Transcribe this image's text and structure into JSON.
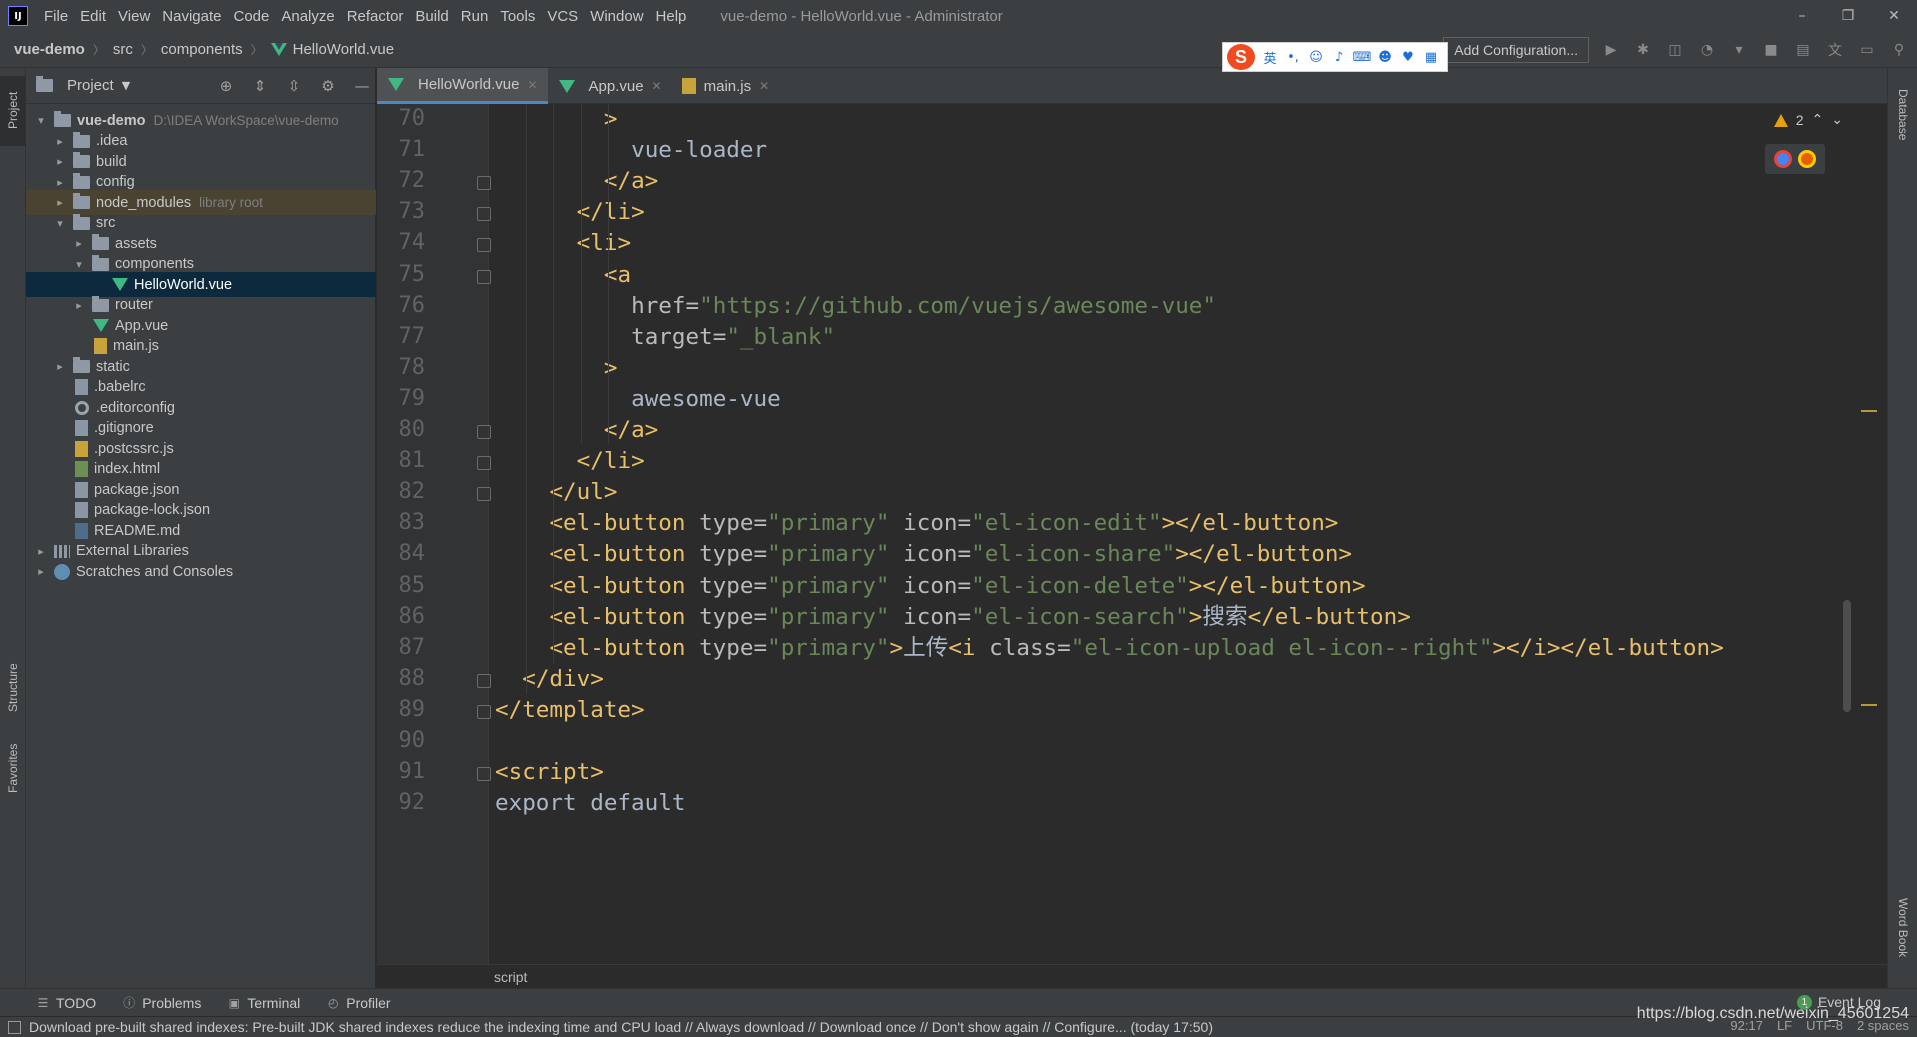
{
  "menu": [
    "File",
    "Edit",
    "View",
    "Navigate",
    "Code",
    "Analyze",
    "Refactor",
    "Build",
    "Run",
    "Tools",
    "VCS",
    "Window",
    "Help"
  ],
  "window_title": "vue-demo - HelloWorld.vue - Administrator",
  "breadcrumb": [
    "vue-demo",
    "src",
    "components",
    "HelloWorld.vue"
  ],
  "run_config_label": "Add Configuration...",
  "ime": {
    "mode": "英"
  },
  "left_strip": {
    "project": "Project",
    "structure": "Structure",
    "favorites": "Favorites"
  },
  "right_strip": {
    "database": "Database",
    "wordbook": "Word Book"
  },
  "project_panel": {
    "title": "Project",
    "tree": [
      {
        "name": "vue-demo",
        "extra": "D:\\IDEA WorkSpace\\vue-demo",
        "depth": 0,
        "kind": "module",
        "expanded": true
      },
      {
        "name": ".idea",
        "depth": 1,
        "kind": "folder",
        "expanded": false
      },
      {
        "name": "build",
        "depth": 1,
        "kind": "folder",
        "expanded": false
      },
      {
        "name": "config",
        "depth": 1,
        "kind": "folder",
        "expanded": false
      },
      {
        "name": "node_modules",
        "extra": "library root",
        "depth": 1,
        "kind": "folder",
        "expanded": false,
        "highlight": true
      },
      {
        "name": "src",
        "depth": 1,
        "kind": "folder",
        "expanded": true
      },
      {
        "name": "assets",
        "depth": 2,
        "kind": "folder",
        "expanded": false
      },
      {
        "name": "components",
        "depth": 2,
        "kind": "folder",
        "expanded": true
      },
      {
        "name": "HelloWorld.vue",
        "depth": 3,
        "kind": "vue",
        "selected": true
      },
      {
        "name": "router",
        "depth": 2,
        "kind": "folder",
        "expanded": false
      },
      {
        "name": "App.vue",
        "depth": 2,
        "kind": "vue"
      },
      {
        "name": "main.js",
        "depth": 2,
        "kind": "js"
      },
      {
        "name": "static",
        "depth": 1,
        "kind": "folder",
        "expanded": false
      },
      {
        "name": ".babelrc",
        "depth": 1,
        "kind": "file"
      },
      {
        "name": ".editorconfig",
        "depth": 1,
        "kind": "gear"
      },
      {
        "name": ".gitignore",
        "depth": 1,
        "kind": "file"
      },
      {
        "name": ".postcssrc.js",
        "depth": 1,
        "kind": "js"
      },
      {
        "name": "index.html",
        "depth": 1,
        "kind": "html"
      },
      {
        "name": "package.json",
        "depth": 1,
        "kind": "file"
      },
      {
        "name": "package-lock.json",
        "depth": 1,
        "kind": "file"
      },
      {
        "name": "README.md",
        "depth": 1,
        "kind": "md"
      },
      {
        "name": "External Libraries",
        "depth": 0,
        "kind": "lib",
        "expanded": false
      },
      {
        "name": "Scratches and Consoles",
        "depth": 0,
        "kind": "scratch",
        "expanded": false
      }
    ]
  },
  "tabs": [
    {
      "label": "HelloWorld.vue",
      "icon": "vue",
      "active": true
    },
    {
      "label": "App.vue",
      "icon": "vue",
      "active": false
    },
    {
      "label": "main.js",
      "icon": "js",
      "active": false
    }
  ],
  "editor": {
    "warnings": "2",
    "lines": [
      {
        "n": "70",
        "indent": 4,
        "tokens": [
          [
            "tg",
            ">"
          ]
        ]
      },
      {
        "n": "71",
        "indent": 5,
        "tokens": [
          [
            "tx",
            "vue-loader"
          ]
        ]
      },
      {
        "n": "72",
        "indent": 4,
        "tokens": [
          [
            "tg",
            "</a>"
          ]
        ]
      },
      {
        "n": "73",
        "indent": 3,
        "tokens": [
          [
            "tg",
            "</li>"
          ]
        ]
      },
      {
        "n": "74",
        "indent": 3,
        "tokens": [
          [
            "tg",
            "<li>"
          ]
        ]
      },
      {
        "n": "75",
        "indent": 4,
        "tokens": [
          [
            "tg",
            "<a"
          ]
        ]
      },
      {
        "n": "76",
        "indent": 5,
        "tokens": [
          [
            "at",
            "href="
          ],
          [
            "st",
            "\"https://github.com/vuejs/awesome-vue\""
          ]
        ]
      },
      {
        "n": "77",
        "indent": 5,
        "tokens": [
          [
            "at",
            "target="
          ],
          [
            "st",
            "\"_blank\""
          ]
        ]
      },
      {
        "n": "78",
        "indent": 4,
        "tokens": [
          [
            "tg",
            ">"
          ]
        ]
      },
      {
        "n": "79",
        "indent": 5,
        "tokens": [
          [
            "tx",
            "awesome-vue"
          ]
        ]
      },
      {
        "n": "80",
        "indent": 4,
        "tokens": [
          [
            "tg",
            "</a>"
          ]
        ]
      },
      {
        "n": "81",
        "indent": 3,
        "tokens": [
          [
            "tg",
            "</li>"
          ]
        ]
      },
      {
        "n": "82",
        "indent": 2,
        "tokens": [
          [
            "tg",
            "</ul>"
          ]
        ]
      },
      {
        "n": "83",
        "indent": 2,
        "tokens": [
          [
            "tg",
            "<el-button "
          ],
          [
            "at",
            "type="
          ],
          [
            "st",
            "\"primary\" "
          ],
          [
            "at",
            "icon="
          ],
          [
            "st",
            "\"el-icon-edit\""
          ],
          [
            "tg",
            "></el-button>"
          ]
        ]
      },
      {
        "n": "84",
        "indent": 2,
        "tokens": [
          [
            "tg",
            "<el-button "
          ],
          [
            "at",
            "type="
          ],
          [
            "st",
            "\"primary\" "
          ],
          [
            "at",
            "icon="
          ],
          [
            "st",
            "\"el-icon-share\""
          ],
          [
            "tg",
            "></el-button>"
          ]
        ]
      },
      {
        "n": "85",
        "indent": 2,
        "tokens": [
          [
            "tg",
            "<el-button "
          ],
          [
            "at",
            "type="
          ],
          [
            "st",
            "\"primary\" "
          ],
          [
            "at",
            "icon="
          ],
          [
            "st",
            "\"el-icon-delete\""
          ],
          [
            "tg",
            "></el-button>"
          ]
        ]
      },
      {
        "n": "86",
        "indent": 2,
        "tokens": [
          [
            "tg",
            "<el-button "
          ],
          [
            "at",
            "type="
          ],
          [
            "st",
            "\"primary\" "
          ],
          [
            "at",
            "icon="
          ],
          [
            "st",
            "\"el-icon-search\""
          ],
          [
            "tg",
            ">"
          ],
          [
            "tx",
            "搜索"
          ],
          [
            "tg",
            "</el-button>"
          ]
        ]
      },
      {
        "n": "87",
        "indent": 2,
        "tokens": [
          [
            "tg",
            "<el-button "
          ],
          [
            "at",
            "type="
          ],
          [
            "st",
            "\"primary\""
          ],
          [
            "tg",
            ">"
          ],
          [
            "tx",
            "上传"
          ],
          [
            "tg",
            "<i "
          ],
          [
            "at",
            "class="
          ],
          [
            "st",
            "\"el-icon-upload el-icon--right\""
          ],
          [
            "tg",
            "></i></el-button>"
          ]
        ]
      },
      {
        "n": "88",
        "indent": 1,
        "tokens": [
          [
            "tg",
            "</div>"
          ]
        ]
      },
      {
        "n": "89",
        "indent": 0,
        "tokens": [
          [
            "tg",
            "</template>"
          ]
        ]
      },
      {
        "n": "90",
        "indent": 0,
        "tokens": []
      },
      {
        "n": "91",
        "indent": 0,
        "tokens": [
          [
            "tg",
            "<script>"
          ]
        ]
      },
      {
        "n": "92",
        "indent": 0,
        "tokens": [
          [
            "tx",
            "export default "
          ]
        ]
      }
    ]
  },
  "editor_crumb": "script",
  "tool_windows": [
    "TODO",
    "Problems",
    "Terminal",
    "Profiler"
  ],
  "event_log": {
    "label": "Event Log",
    "count": "1"
  },
  "status_message": "Download pre-built shared indexes: Pre-built JDK shared indexes reduce the indexing time and CPU load // Always download // Download once // Don't show again // Configure... (today 17:50)",
  "status_right": [
    "92:17",
    "LF",
    "UTF-8",
    "2 spaces"
  ],
  "watermark": "https://blog.csdn.net/weixin_45601254",
  "colors": {
    "tag": "#e8bf6a",
    "attr": "#bababa",
    "string": "#6a8759",
    "text": "#a9b7c6",
    "selection": "#0d293e"
  }
}
